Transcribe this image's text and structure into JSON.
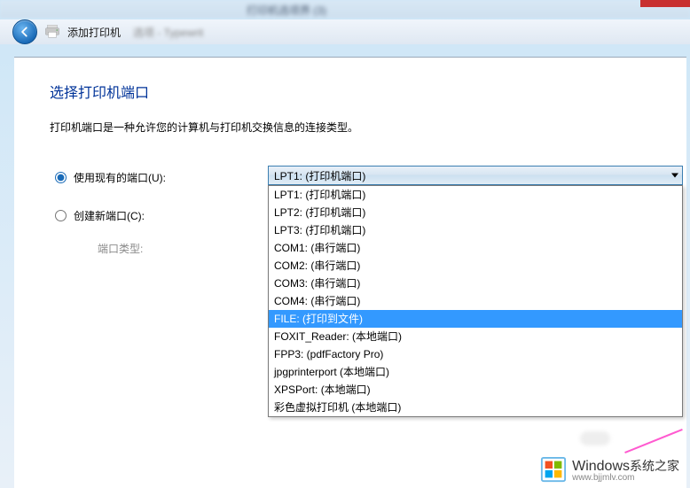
{
  "top_blur_text": "打印机选项界 (3)",
  "title": {
    "back_icon": "back-arrow-icon",
    "printer_icon": "printer-icon",
    "text": "添加打印机",
    "blur_suffix": "选项 - Typewrit"
  },
  "dialog": {
    "heading": "选择打印机端口",
    "desc": "打印机端口是一种允许您的计算机与打印机交换信息的连接类型。",
    "options": {
      "use_existing": {
        "label": "使用现有的端口(U):",
        "checked": true
      },
      "create_new": {
        "label": "创建新端口(C):",
        "checked": false
      },
      "port_type_label": "端口类型:"
    },
    "combo_selected": "LPT1: (打印机端口)",
    "dropdown_items": [
      {
        "label": "LPT1: (打印机端口)",
        "selected": false
      },
      {
        "label": "LPT2: (打印机端口)",
        "selected": false
      },
      {
        "label": "LPT3: (打印机端口)",
        "selected": false
      },
      {
        "label": "COM1: (串行端口)",
        "selected": false
      },
      {
        "label": "COM2: (串行端口)",
        "selected": false
      },
      {
        "label": "COM3: (串行端口)",
        "selected": false
      },
      {
        "label": "COM4: (串行端口)",
        "selected": false
      },
      {
        "label": "FILE: (打印到文件)",
        "selected": true
      },
      {
        "label": "FOXIT_Reader: (本地端口)",
        "selected": false
      },
      {
        "label": "FPP3: (pdfFactory Pro)",
        "selected": false
      },
      {
        "label": "jpgprinterport (本地端口)",
        "selected": false
      },
      {
        "label": "XPSPort: (本地端口)",
        "selected": false
      },
      {
        "label": "彩色虚拟打印机 (本地端口)",
        "selected": false
      }
    ]
  },
  "watermark": {
    "brand": "Windows",
    "suffix": "系统之家",
    "url": "www.bjjmlv.com"
  }
}
